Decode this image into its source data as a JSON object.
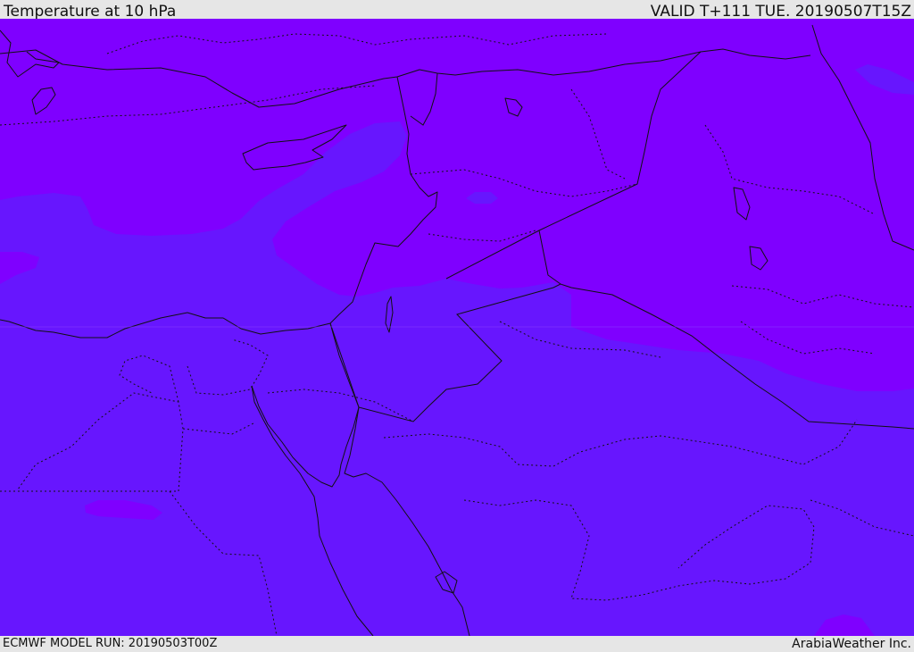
{
  "header": {
    "title": "Temperature at 10 hPa",
    "valid": "VALID T+111 TUE. 20190507T15Z"
  },
  "footer": {
    "model_run": "ECMWF MODEL RUN: 20190503T00Z",
    "credit": "ArabiaWeather Inc."
  },
  "map": {
    "field": "temperature",
    "level": "10 hPa",
    "colors": {
      "cold_band": "#7f00ff",
      "warmer_band": "#6716fe",
      "coastline": "#111111",
      "borders": "#111111"
    }
  }
}
